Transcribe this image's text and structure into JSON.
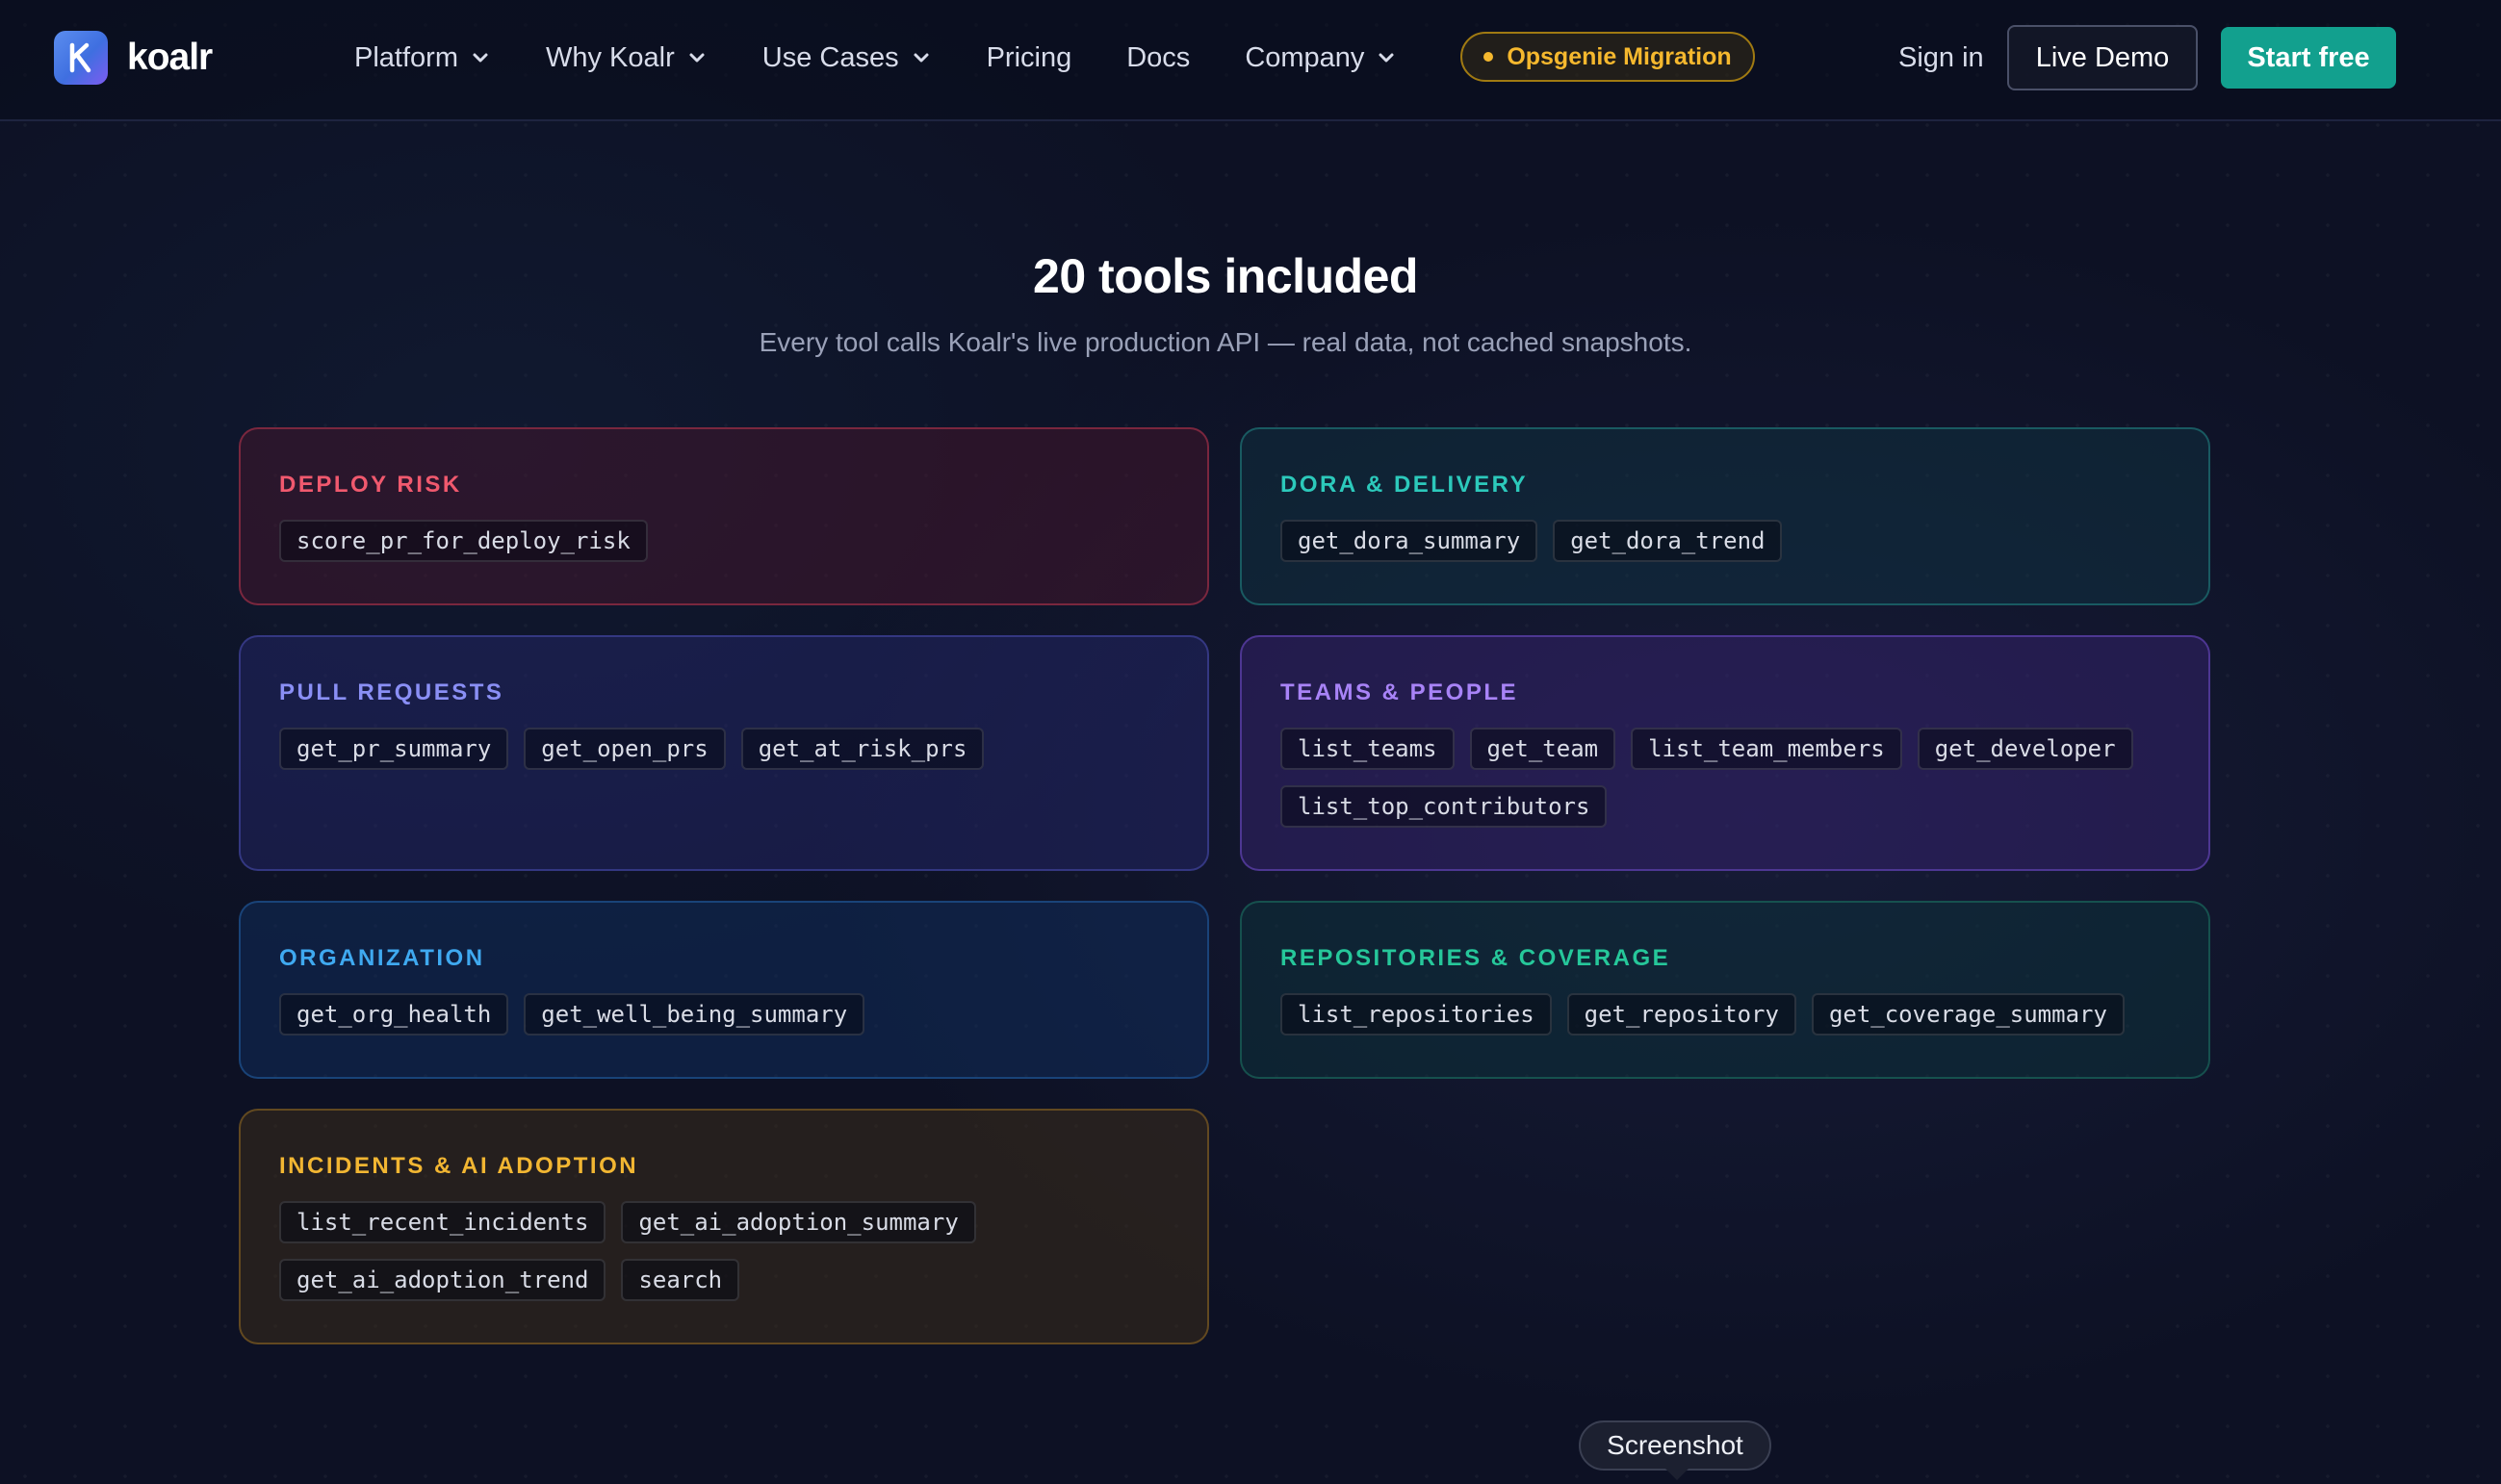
{
  "brand": {
    "name": "koalr",
    "logo_letter": "K"
  },
  "nav": {
    "items": [
      {
        "label": "Platform",
        "has_dropdown": true
      },
      {
        "label": "Why Koalr",
        "has_dropdown": true
      },
      {
        "label": "Use Cases",
        "has_dropdown": true
      },
      {
        "label": "Pricing",
        "has_dropdown": false
      },
      {
        "label": "Docs",
        "has_dropdown": false
      },
      {
        "label": "Company",
        "has_dropdown": true
      }
    ],
    "migration_label": "Opsgenie Migration",
    "signin_label": "Sign in",
    "demo_label": "Live Demo",
    "start_label": "Start free"
  },
  "section": {
    "title": "20 tools included",
    "subtitle": "Every tool calls Koalr's live production API — real data, not cached snapshots."
  },
  "categories": [
    {
      "title": "DEPLOY RISK",
      "color": "#f0596e",
      "tools": [
        "score_pr_for_deploy_risk"
      ]
    },
    {
      "title": "DORA & DELIVERY",
      "color": "#2cc9bb",
      "tools": [
        "get_dora_summary",
        "get_dora_trend"
      ]
    },
    {
      "title": "PULL REQUESTS",
      "color": "#8a8ff5",
      "tools": [
        "get_pr_summary",
        "get_open_prs",
        "get_at_risk_prs"
      ]
    },
    {
      "title": "TEAMS & PEOPLE",
      "color": "#a883f7",
      "tools": [
        "list_teams",
        "get_team",
        "list_team_members",
        "get_developer",
        "list_top_contributors"
      ]
    },
    {
      "title": "ORGANIZATION",
      "color": "#3fa9f0",
      "tools": [
        "get_org_health",
        "get_well_being_summary"
      ]
    },
    {
      "title": "REPOSITORIES & COVERAGE",
      "color": "#26c79a",
      "tools": [
        "list_repositories",
        "get_repository",
        "get_coverage_summary"
      ]
    },
    {
      "title": "INCIDENTS & AI ADOPTION",
      "color": "#f2b632",
      "tools": [
        "list_recent_incidents",
        "get_ai_adoption_summary",
        "get_ai_adoption_trend",
        "search"
      ]
    }
  ],
  "tooltip": {
    "label": "Screenshot"
  },
  "colors": {
    "accent": "#12a08e",
    "migration": "#f5b82e",
    "background": "#0d1124"
  }
}
